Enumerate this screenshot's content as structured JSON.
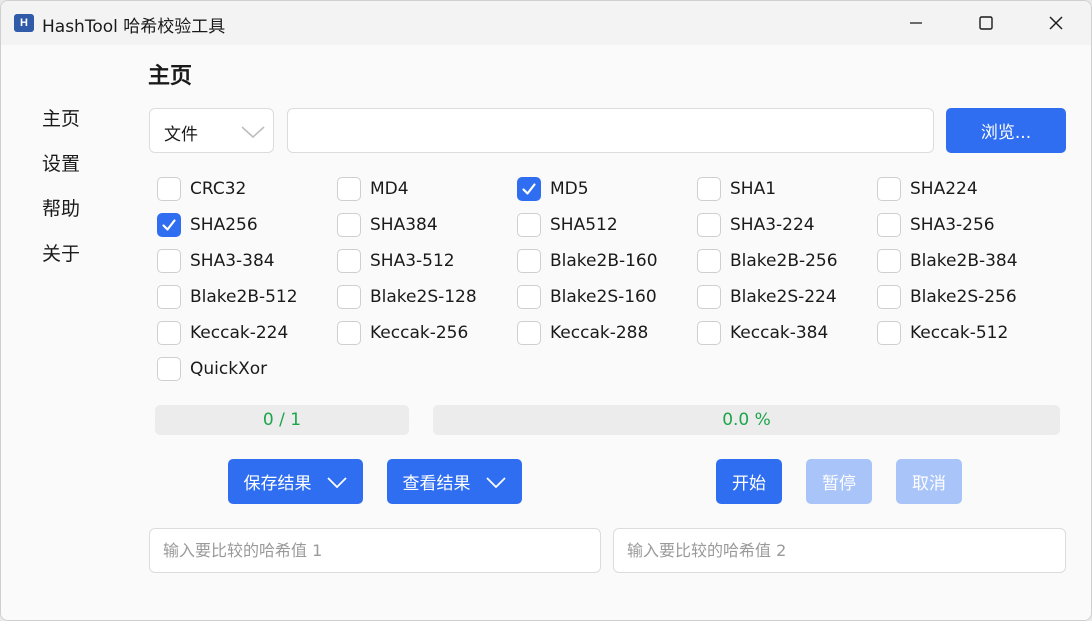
{
  "window": {
    "icon_letter": "H",
    "title": "HashTool 哈希校验工具"
  },
  "nav": {
    "items": [
      "主页",
      "设置",
      "帮助",
      "关于"
    ]
  },
  "page": {
    "title": "主页"
  },
  "source": {
    "mode_selected": "文件",
    "path_value": "",
    "browse_label": "浏览..."
  },
  "algorithms": [
    {
      "name": "CRC32",
      "checked": false
    },
    {
      "name": "MD4",
      "checked": false
    },
    {
      "name": "MD5",
      "checked": true
    },
    {
      "name": "SHA1",
      "checked": false
    },
    {
      "name": "SHA224",
      "checked": false
    },
    {
      "name": "SHA256",
      "checked": true
    },
    {
      "name": "SHA384",
      "checked": false
    },
    {
      "name": "SHA512",
      "checked": false
    },
    {
      "name": "SHA3-224",
      "checked": false
    },
    {
      "name": "SHA3-256",
      "checked": false
    },
    {
      "name": "SHA3-384",
      "checked": false
    },
    {
      "name": "SHA3-512",
      "checked": false
    },
    {
      "name": "Blake2B-160",
      "checked": false
    },
    {
      "name": "Blake2B-256",
      "checked": false
    },
    {
      "name": "Blake2B-384",
      "checked": false
    },
    {
      "name": "Blake2B-512",
      "checked": false
    },
    {
      "name": "Blake2S-128",
      "checked": false
    },
    {
      "name": "Blake2S-160",
      "checked": false
    },
    {
      "name": "Blake2S-224",
      "checked": false
    },
    {
      "name": "Blake2S-256",
      "checked": false
    },
    {
      "name": "Keccak-224",
      "checked": false
    },
    {
      "name": "Keccak-256",
      "checked": false
    },
    {
      "name": "Keccak-288",
      "checked": false
    },
    {
      "name": "Keccak-384",
      "checked": false
    },
    {
      "name": "Keccak-512",
      "checked": false
    },
    {
      "name": "QuickXor",
      "checked": false
    }
  ],
  "progress": {
    "files_text": "0 / 1",
    "files_fraction": 0,
    "percent_text": "0.0 %",
    "percent_value": 0
  },
  "actions": {
    "save_results": "保存结果",
    "view_results": "查看结果",
    "start": "开始",
    "pause": "暂停",
    "cancel": "取消"
  },
  "compare": {
    "hash1_placeholder": "输入要比较的哈希值 1",
    "hash1_value": "",
    "hash2_placeholder": "输入要比较的哈希值 2",
    "hash2_value": ""
  },
  "colors": {
    "accent": "#2f6ef0",
    "accent_disabled": "#a9c4f8",
    "progress_text": "#1da54a"
  }
}
